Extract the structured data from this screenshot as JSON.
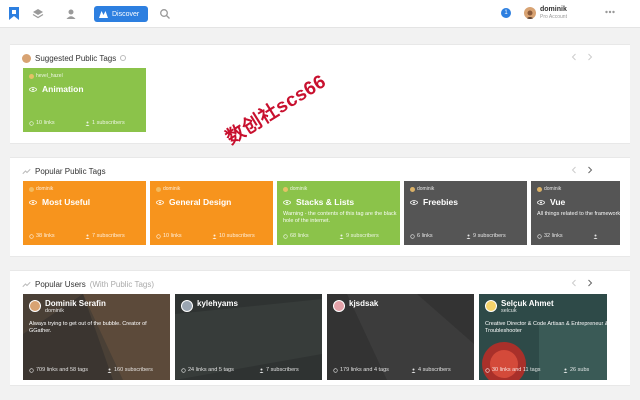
{
  "topbar": {
    "discover_label": "Discover",
    "notification_count": "1",
    "user_name": "dominik",
    "user_plan": "Pro Account"
  },
  "suggested": {
    "title": "Suggested Public Tags",
    "cards": [
      {
        "owner": "hevel_hazel",
        "title": "Animation",
        "desc": "",
        "links": "10 links",
        "subscribers": "1 subscribers",
        "color": "#8bc34a"
      }
    ]
  },
  "popular_tags": {
    "title": "Popular Public Tags",
    "cards": [
      {
        "owner": "dominik",
        "title": "Most Useful",
        "desc": "",
        "links": "38 links",
        "subscribers": "7 subscribers",
        "color": "#f7941d"
      },
      {
        "owner": "dominik",
        "title": "General Design",
        "desc": "",
        "links": "10 links",
        "subscribers": "10 subscribers",
        "color": "#f7941d"
      },
      {
        "owner": "dominik",
        "title": "Stacks & Lists",
        "desc": "Warning - the contents of this tag are the black hole of the internet.",
        "links": "68 links",
        "subscribers": "9 subscribers",
        "color": "#8bc34a"
      },
      {
        "owner": "dominik",
        "title": "Freebies",
        "desc": "",
        "links": "6 links",
        "subscribers": "9 subscribers",
        "color": "#555555"
      },
      {
        "owner": "dominik",
        "title": "Vue",
        "desc": "All things related to the framework.",
        "links": "32 links",
        "subscribers": "",
        "color": "#555555"
      }
    ]
  },
  "popular_users": {
    "title": "Popular Users",
    "subtitle": "(With Public Tags)",
    "cards": [
      {
        "name": "Dominik Serafin",
        "handle": "dominik",
        "bio": "Always trying to get out of the bubble. Creator of GGather.",
        "links": "709 links and 58 tags",
        "subscribers": "160 subscribers",
        "avatar_color": "#d8a373"
      },
      {
        "name": "kylehyams",
        "handle": "",
        "bio": "",
        "links": "24 links and 5 tags",
        "subscribers": "7 subscribers",
        "avatar_color": "#9aa5b1"
      },
      {
        "name": "kjsdsak",
        "handle": "",
        "bio": "",
        "links": "179 links and 4 tags",
        "subscribers": "4 subscribers",
        "avatar_color": "#e3a1a8"
      },
      {
        "name": "Selçuk Ahmet",
        "handle": "selcuk",
        "bio": "Creative Director & Code Artisan & Entrepreneur & Troubleshooter",
        "links": "30 links and 11 tags",
        "subscribers": "26 subs",
        "avatar_color": "#f5d36b"
      }
    ]
  },
  "watermark": "数创社scs66"
}
